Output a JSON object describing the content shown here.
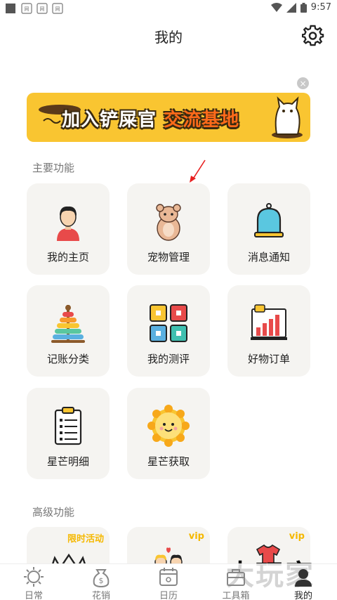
{
  "status_bar": {
    "time": "9:57",
    "app_label_1": "网易\n有道",
    "app_label_2": "网易\n有道",
    "app_label_3": "网易\n有道"
  },
  "header": {
    "title": "我的"
  },
  "banner": {
    "text_part1": "加入铲屎官",
    "text_part2": "交流基地",
    "close_symbol": "×"
  },
  "sections": {
    "main_title": "主要功能",
    "advanced_title": "高级功能"
  },
  "main_features": [
    {
      "label": "我的主页",
      "icon": "user-icon"
    },
    {
      "label": "宠物管理",
      "icon": "hamster-icon"
    },
    {
      "label": "消息通知",
      "icon": "bell-icon"
    },
    {
      "label": "记账分类",
      "icon": "ring-stack-icon"
    },
    {
      "label": "我的测评",
      "icon": "grid-icon"
    },
    {
      "label": "好物订单",
      "icon": "chart-icon"
    },
    {
      "label": "星芒明细",
      "icon": "clipboard-icon"
    },
    {
      "label": "星芒获取",
      "icon": "sun-icon"
    }
  ],
  "advanced_features": [
    {
      "tag": "限时活动",
      "icon": "crown-icon"
    },
    {
      "tag": "vip",
      "icon": "couple-icon"
    },
    {
      "tag": "vip",
      "icon": "shirt-icon"
    }
  ],
  "bottom_nav": [
    {
      "label": "日常",
      "icon": "sun-outline-icon",
      "active": false
    },
    {
      "label": "花销",
      "icon": "money-bag-icon",
      "active": false
    },
    {
      "label": "日历",
      "icon": "calendar-icon",
      "active": false
    },
    {
      "label": "工具箱",
      "icon": "toolbox-icon",
      "active": false
    },
    {
      "label": "我的",
      "icon": "profile-icon",
      "active": true
    }
  ],
  "watermark": "大玩家",
  "colors": {
    "accent": "#f9c531",
    "card_bg": "#f5f4f1",
    "vip": "#f5b800"
  }
}
